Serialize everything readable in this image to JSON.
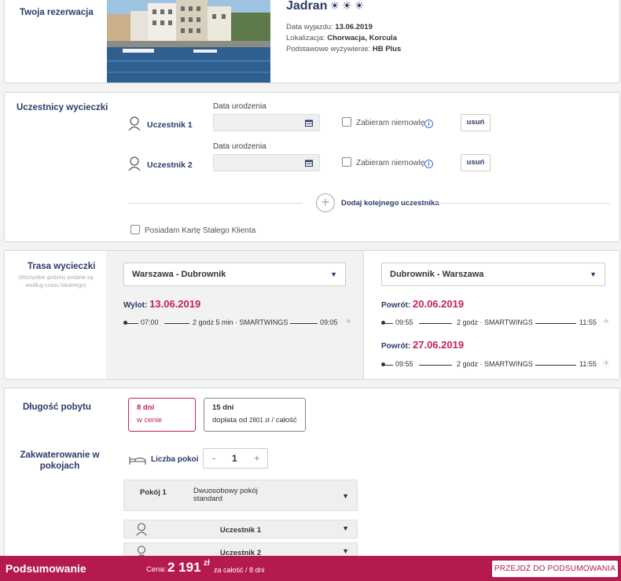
{
  "reservation": {
    "section_title": "Twoja rezerwacja",
    "hotel_name": "Jadran",
    "departure_label": "Data wyjazdu:",
    "departure_value": "13.06.2019",
    "location_label": "Lokalizacja:",
    "location_value": "Chorwacja, Korcula",
    "board_label": "Podstawowe wyżywienie:",
    "board_value": "HB Plus"
  },
  "participants": {
    "section_title": "Uczestnicy wycieczki",
    "items": [
      {
        "name": "Uczestnik 1",
        "dob_label": "Data urodzenia",
        "dob_value": "",
        "infant_label": "Zabieram niemowlę",
        "remove_label": "usuń"
      },
      {
        "name": "Uczestnik 2",
        "dob_label": "Data urodzenia",
        "dob_value": "",
        "infant_label": "Zabieram niemowlę",
        "remove_label": "usuń"
      }
    ],
    "add_label": "Dodaj kolejnego uczestnika",
    "loyalty_label": "Posiadam Kartę Stałego Klienta"
  },
  "route": {
    "section_title": "Trasa wycieczki",
    "note": "(Wszystkie godziny podane są według czasu lokalnego)",
    "outbound": {
      "select_value": "Warszawa - Dubrownik",
      "label": "Wylot:",
      "date": "13.06.2019",
      "depart": "07:00",
      "info": "2 godz 5 min · SMARTWINGS",
      "arrive": "09:05"
    },
    "returns": {
      "select_value": "Dubrownik - Warszawa",
      "items": [
        {
          "label": "Powrót:",
          "date": "20.06.2019",
          "depart": "09:55",
          "info": "2 godz · SMARTWINGS",
          "arrive": "11:55"
        },
        {
          "label": "Powrót:",
          "date": "27.06.2019",
          "depart": "09:55",
          "info": "2 godz · SMARTWINGS",
          "arrive": "11:55"
        }
      ]
    }
  },
  "stay": {
    "duration_title": "Długość pobytu",
    "options": [
      {
        "days": "8 dni",
        "sub": "w cenie",
        "selected": true
      },
      {
        "days": "15 dni",
        "sub_prefix": "dopłata od",
        "sub_amount": "2801 zł",
        "sub_suffix": "/ całość",
        "selected": false
      }
    ],
    "accommodation_title": "Zakwaterowanie w pokojach",
    "rooms_label": "Liczba pokoi",
    "rooms_minus": "-",
    "rooms_value": "1",
    "rooms_plus": "+",
    "room": {
      "label": "Pokój 1",
      "type": "Dwuosobowy pokój standard"
    },
    "room_participants": [
      "Uczestnik 1",
      "Uczestnik 2"
    ]
  },
  "summary": {
    "title": "Podsumowanie",
    "price_label": "Cena:",
    "price": "2 191",
    "currency": "zł",
    "note": "za całość / 8 dni",
    "button": "PRZEJDŹ DO PODSUMOWANIA"
  },
  "colors": {
    "navy": "#2d3a6b",
    "accent": "#c51f5d",
    "bar": "#b41a4f"
  }
}
